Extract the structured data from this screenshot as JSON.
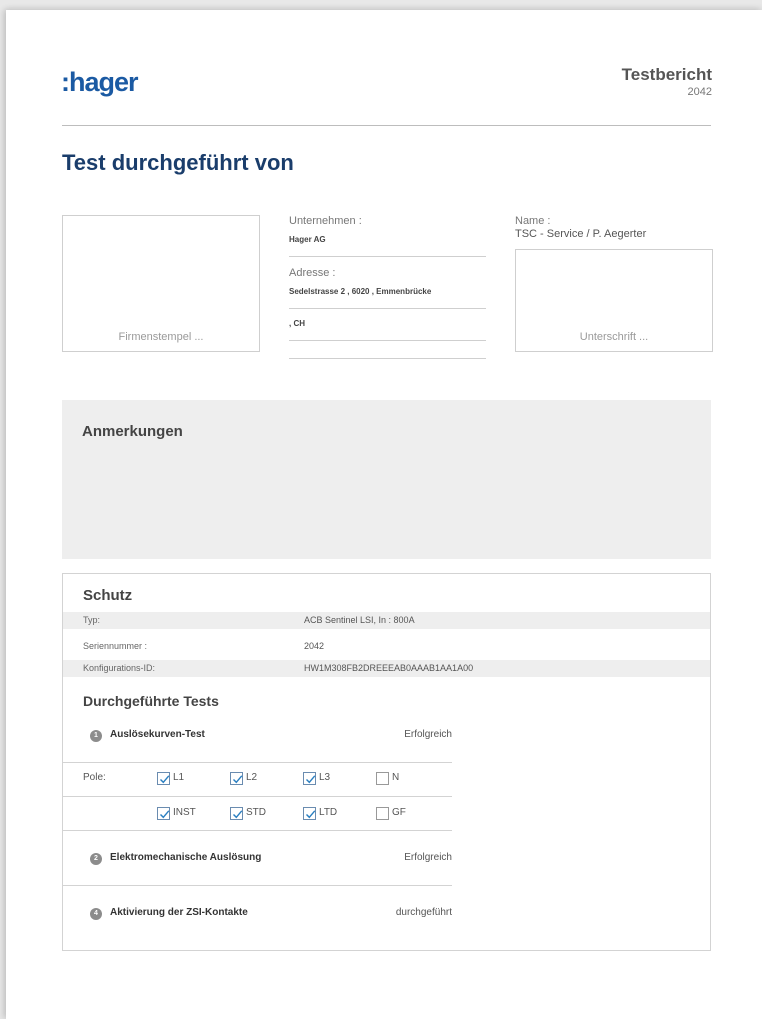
{
  "header": {
    "logo_text": ":hager",
    "report_title": "Testbericht",
    "report_number": "2042"
  },
  "performed_by": {
    "heading": "Test durchgeführt von",
    "stamp_placeholder": "Firmenstempel ...",
    "company_label": "Unternehmen :",
    "company_value": "Hager AG",
    "address_label": "Adresse :",
    "address_line1": "Sedelstrasse 2 , 6020 , Emmenbrücke",
    "address_line2": ", CH",
    "name_label": "Name :",
    "name_value": "TSC - Service / P. Aegerter",
    "signature_placeholder": "Unterschrift ..."
  },
  "remarks": {
    "heading": "Anmerkungen"
  },
  "protection": {
    "heading": "Schutz",
    "rows": [
      {
        "key": "Typ:",
        "value": "ACB Sentinel LSI, In : 800A"
      },
      {
        "key": "Seriennummer :",
        "value": "2042"
      },
      {
        "key": "Konfigurations-ID:",
        "value": "HW1M308FB2DREEEAB0AAAB1AA1A00"
      }
    ],
    "tests_heading": "Durchgeführte Tests",
    "tests": [
      {
        "badge": "1",
        "name": "Auslösekurven-Test",
        "status": "Erfolgreich"
      },
      {
        "badge": "2",
        "name": "Elektromechanische Auslösung",
        "status": "Erfolgreich"
      },
      {
        "badge": "4",
        "name": "Aktivierung der ZSI-Kontakte",
        "status": "durchgeführt"
      }
    ],
    "poles_label": "Pole:",
    "poles": [
      {
        "label": "L1",
        "checked": true
      },
      {
        "label": "L2",
        "checked": true
      },
      {
        "label": "L3",
        "checked": true
      },
      {
        "label": "N",
        "checked": false
      }
    ],
    "functions": [
      {
        "label": "INST",
        "checked": true
      },
      {
        "label": "STD",
        "checked": true
      },
      {
        "label": "LTD",
        "checked": true
      },
      {
        "label": "GF",
        "checked": false
      }
    ]
  },
  "colors": {
    "brand": "#1b5aa3",
    "heading": "#1a3d6b",
    "shade": "#eeeeee"
  }
}
